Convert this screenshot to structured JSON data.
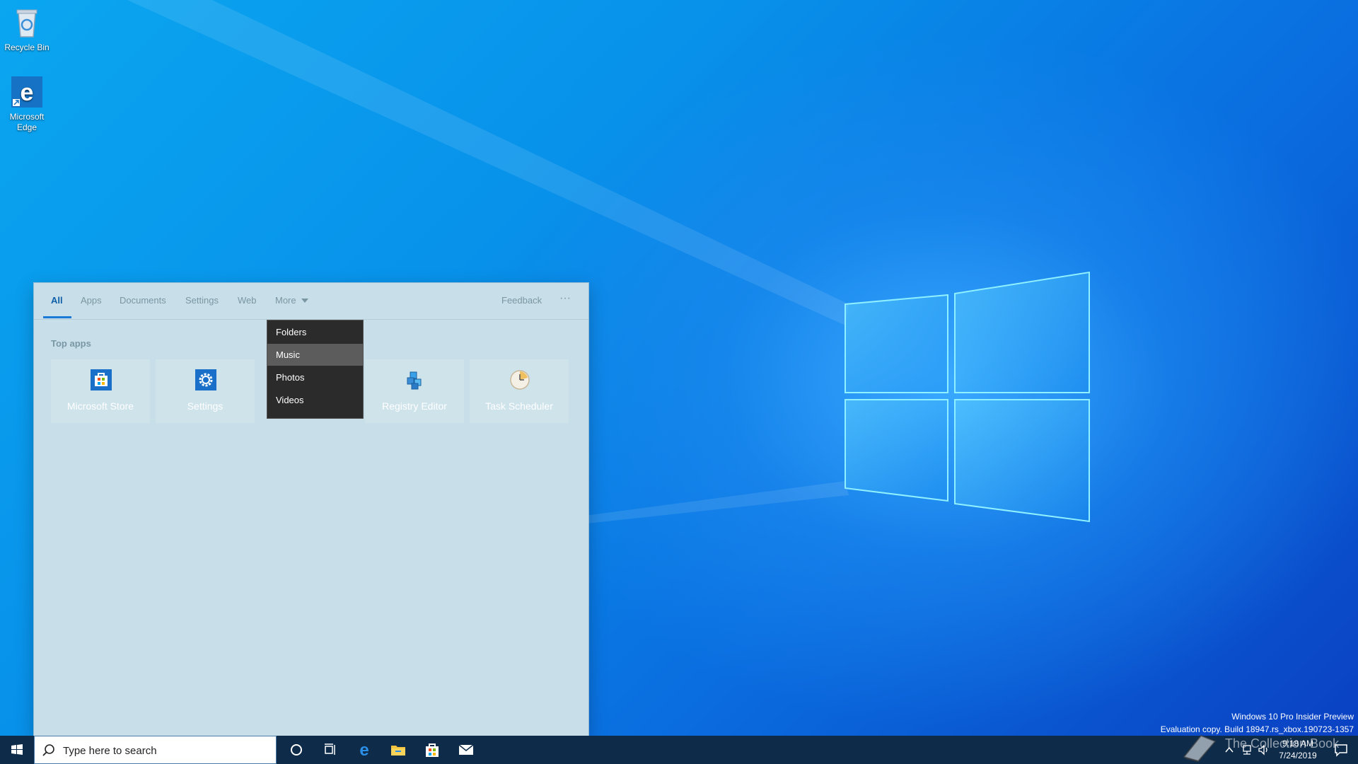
{
  "desktop": {
    "icons": [
      {
        "label": "Recycle Bin",
        "icon": "recycle-bin-icon"
      },
      {
        "label": "Microsoft Edge",
        "icon": "edge-icon"
      }
    ]
  },
  "search_flyout": {
    "tabs": [
      {
        "label": "All",
        "active": true
      },
      {
        "label": "Apps"
      },
      {
        "label": "Documents"
      },
      {
        "label": "Settings"
      },
      {
        "label": "Web"
      },
      {
        "label": "More"
      }
    ],
    "feedback_label": "Feedback",
    "more_options_label": "···",
    "top_apps_title": "Top apps",
    "top_apps": [
      {
        "label": "Microsoft Store",
        "icon": "store-icon"
      },
      {
        "label": "Settings",
        "icon": "gear-icon"
      },
      {
        "label": "Registry Editor",
        "icon": "registry-icon"
      },
      {
        "label": "Task Scheduler",
        "icon": "clock-icon"
      }
    ],
    "more_menu": {
      "items": [
        "Folders",
        "Music",
        "Photos",
        "Videos"
      ],
      "highlighted": "Music"
    }
  },
  "watermark": {
    "line1": "Windows 10 Pro Insider Preview",
    "line2": "Evaluation copy. Build 18947.rs_xbox.190723-1357"
  },
  "taskbar": {
    "search_placeholder": "Type here to search",
    "pinned": [
      "cortana-icon",
      "task-view-icon",
      "edge-icon",
      "file-explorer-icon",
      "store-icon",
      "mail-icon"
    ],
    "clock_time": "9:18 AM",
    "clock_date": "7/24/2019"
  },
  "overlay_logo": {
    "text": "The Collection Book"
  },
  "colors": {
    "accent": "#1a7ad6",
    "taskbar": "#0e2b4a",
    "flyout_bg": "#c8dfe9",
    "menu_bg": "#2b2b2b"
  }
}
